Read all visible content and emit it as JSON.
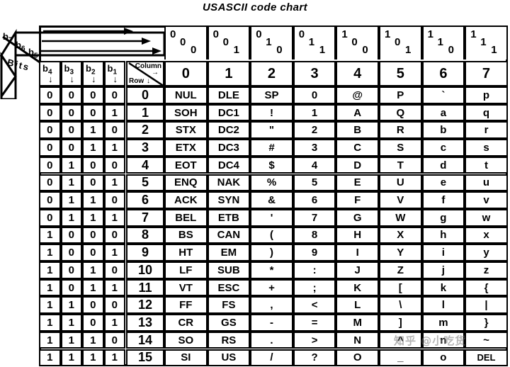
{
  "title": "USASCII code chart",
  "watermark": "知乎 @小吃货",
  "legend": {
    "bits_label": "Bits",
    "high_bits": [
      "b7",
      "b6",
      "b5"
    ],
    "low_bits": [
      "b4",
      "b3",
      "b2",
      "b1"
    ],
    "column_label": "Column",
    "row_label": "Row",
    "arrow_down": "↓",
    "arrow_right": "→"
  },
  "chart_data": {
    "type": "table",
    "title": "USASCII code chart",
    "column_bit_patterns": [
      [
        "0",
        "0",
        "0"
      ],
      [
        "0",
        "0",
        "1"
      ],
      [
        "0",
        "1",
        "0"
      ],
      [
        "0",
        "1",
        "1"
      ],
      [
        "1",
        "0",
        "0"
      ],
      [
        "1",
        "0",
        "1"
      ],
      [
        "1",
        "1",
        "0"
      ],
      [
        "1",
        "1",
        "1"
      ]
    ],
    "column_headers": [
      "0",
      "1",
      "2",
      "3",
      "4",
      "5",
      "6",
      "7"
    ],
    "row_bit_patterns": [
      [
        "0",
        "0",
        "0",
        "0"
      ],
      [
        "0",
        "0",
        "0",
        "1"
      ],
      [
        "0",
        "0",
        "1",
        "0"
      ],
      [
        "0",
        "0",
        "1",
        "1"
      ],
      [
        "0",
        "1",
        "0",
        "0"
      ],
      [
        "0",
        "1",
        "0",
        "1"
      ],
      [
        "0",
        "1",
        "1",
        "0"
      ],
      [
        "0",
        "1",
        "1",
        "1"
      ],
      [
        "1",
        "0",
        "0",
        "0"
      ],
      [
        "1",
        "0",
        "0",
        "1"
      ],
      [
        "1",
        "0",
        "1",
        "0"
      ],
      [
        "1",
        "0",
        "1",
        "1"
      ],
      [
        "1",
        "1",
        "0",
        "0"
      ],
      [
        "1",
        "1",
        "0",
        "1"
      ],
      [
        "1",
        "1",
        "1",
        "0"
      ],
      [
        "1",
        "1",
        "1",
        "1"
      ]
    ],
    "row_headers": [
      "0",
      "1",
      "2",
      "3",
      "4",
      "5",
      "6",
      "7",
      "8",
      "9",
      "10",
      "11",
      "12",
      "13",
      "14",
      "15"
    ],
    "cells": [
      [
        "NUL",
        "DLE",
        "SP",
        "0",
        "@",
        "P",
        "`",
        "p"
      ],
      [
        "SOH",
        "DC1",
        "!",
        "1",
        "A",
        "Q",
        "a",
        "q"
      ],
      [
        "STX",
        "DC2",
        "\"",
        "2",
        "B",
        "R",
        "b",
        "r"
      ],
      [
        "ETX",
        "DC3",
        "#",
        "3",
        "C",
        "S",
        "c",
        "s"
      ],
      [
        "EOT",
        "DC4",
        "$",
        "4",
        "D",
        "T",
        "d",
        "t"
      ],
      [
        "ENQ",
        "NAK",
        "%",
        "5",
        "E",
        "U",
        "e",
        "u"
      ],
      [
        "ACK",
        "SYN",
        "&",
        "6",
        "F",
        "V",
        "f",
        "v"
      ],
      [
        "BEL",
        "ETB",
        "'",
        "7",
        "G",
        "W",
        "g",
        "w"
      ],
      [
        "BS",
        "CAN",
        "(",
        "8",
        "H",
        "X",
        "h",
        "x"
      ],
      [
        "HT",
        "EM",
        ")",
        "9",
        "I",
        "Y",
        "i",
        "y"
      ],
      [
        "LF",
        "SUB",
        "*",
        ":",
        "J",
        "Z",
        "j",
        "z"
      ],
      [
        "VT",
        "ESC",
        "+",
        ";",
        "K",
        "[",
        "k",
        "{"
      ],
      [
        "FF",
        "FS",
        ",",
        "<",
        "L",
        "\\",
        "l",
        "|"
      ],
      [
        "CR",
        "GS",
        "-",
        "=",
        "M",
        "]",
        "m",
        "}"
      ],
      [
        "SO",
        "RS",
        ".",
        ">",
        "N",
        "^",
        "n",
        "~"
      ],
      [
        "SI",
        "US",
        "/",
        "?",
        "O",
        "_",
        "o",
        "DEL"
      ]
    ]
  }
}
